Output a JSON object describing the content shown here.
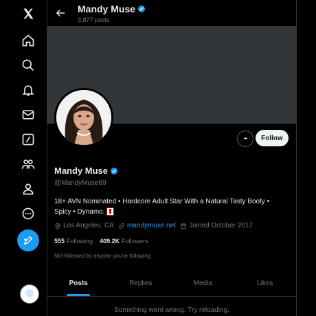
{
  "profile": {
    "name": "Mandy Muse",
    "posts_count": "3,877 posts",
    "handle": "@MandyMuse69",
    "bio": "18+ AVN Nominated • Hardcore Adult Star With a Natural Tasty Booty • Spicy • Dynamo.",
    "location": "Los Angeles, CA",
    "website": "mandymuse.net",
    "joined": "Joined October 2017",
    "following_count": "555",
    "following_label": "Following",
    "followers_count": "409.2K",
    "followers_label": "Followers",
    "not_followed": "Not followed by anyone you're following"
  },
  "actions": {
    "follow_label": "Follow",
    "more_label": "•••"
  },
  "tabs": [
    {
      "label": "Posts",
      "active": true
    },
    {
      "label": "Replies",
      "active": false
    },
    {
      "label": "Media",
      "active": false
    },
    {
      "label": "Likes",
      "active": false
    }
  ],
  "error_message": "Something went wrong. Try reloading.",
  "nav_icons": [
    "x-logo-icon",
    "home-icon",
    "search-icon",
    "bell-icon",
    "mail-icon",
    "grok-icon",
    "communities-icon",
    "profile-icon",
    "more-icon",
    "compose-icon"
  ],
  "colors": {
    "accent": "#1d9bf0",
    "background": "#000000",
    "banner": "#333639",
    "muted": "#71767b"
  }
}
